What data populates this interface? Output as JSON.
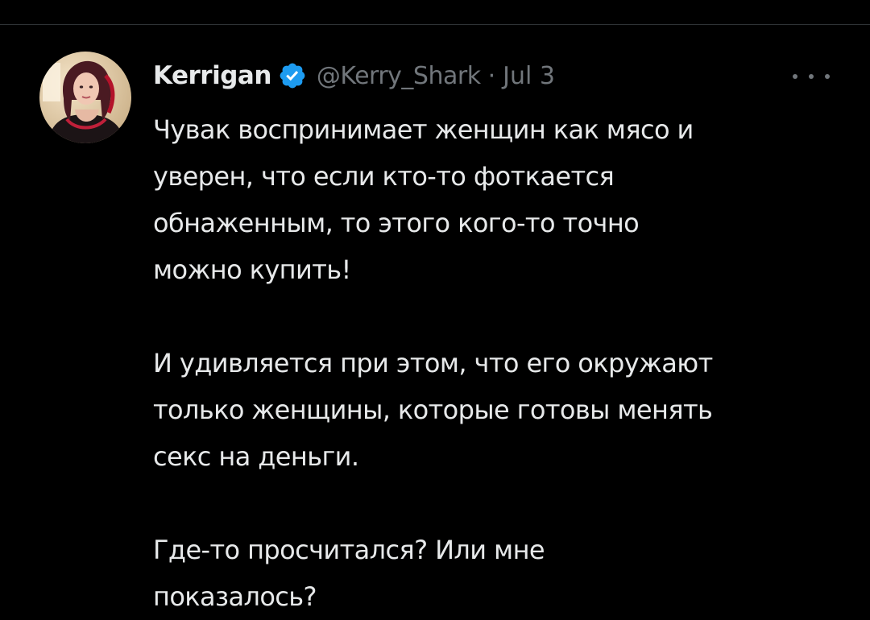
{
  "tweet": {
    "author": {
      "display_name": "Kerrigan",
      "handle": "@Kerry_Shark",
      "verified_icon": "verified-badge-icon",
      "avatar": "profile-avatar-photo"
    },
    "separator": "·",
    "date": "Jul 3",
    "more_icon": "more-options-icon",
    "paragraphs": [
      [
        "Чувак воспринимает женщин как мясо и",
        "уверен, что если кто-то фоткается",
        "обнаженным, то этого кого-то точно",
        "можно купить!"
      ],
      [
        "И удивляется при этом, что его окружают",
        "только женщины, которые готовы менять",
        "секс на деньги."
      ],
      [
        "Где-то просчитался? Или мне",
        "показалось?"
      ]
    ]
  },
  "colors": {
    "background": "#000000",
    "text_primary": "#e7e9ea",
    "text_secondary": "#71767b",
    "verified_blue": "#1d9bf0",
    "divider": "#2f3336"
  }
}
